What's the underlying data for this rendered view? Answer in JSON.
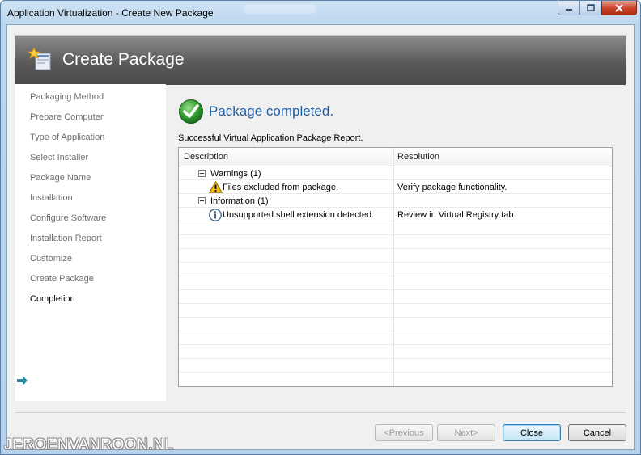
{
  "window": {
    "title": "Application Virtualization - Create New Package"
  },
  "header": {
    "title": "Create Package"
  },
  "nav": {
    "items": [
      {
        "label": "Packaging Method"
      },
      {
        "label": "Prepare Computer"
      },
      {
        "label": "Type of Application"
      },
      {
        "label": "Select Installer"
      },
      {
        "label": "Package Name"
      },
      {
        "label": "Installation"
      },
      {
        "label": "Configure Software"
      },
      {
        "label": "Installation Report"
      },
      {
        "label": "Customize"
      },
      {
        "label": "Create Package"
      },
      {
        "label": "Completion"
      }
    ],
    "active_index": 10
  },
  "status": {
    "title": "Package completed.",
    "report_label": "Successful Virtual Application Package Report."
  },
  "report": {
    "columns": [
      "Description",
      "Resolution"
    ],
    "groups": [
      {
        "label": "Warnings (1)",
        "icon": "warning-icon",
        "items": [
          {
            "description": "Files excluded from package.",
            "resolution": "Verify package functionality."
          }
        ]
      },
      {
        "label": "Information (1)",
        "icon": "info-icon",
        "items": [
          {
            "description": "Unsupported shell extension detected.",
            "resolution": "Review in Virtual Registry tab."
          }
        ]
      }
    ]
  },
  "buttons": {
    "previous": "<Previous",
    "next": "Next>",
    "close": "Close",
    "cancel": "Cancel"
  },
  "watermark": "JEROENVANROON.NL",
  "colors": {
    "accent": "#1f5fa8",
    "success": "#2e9b2e",
    "warning": "#f2c200"
  }
}
